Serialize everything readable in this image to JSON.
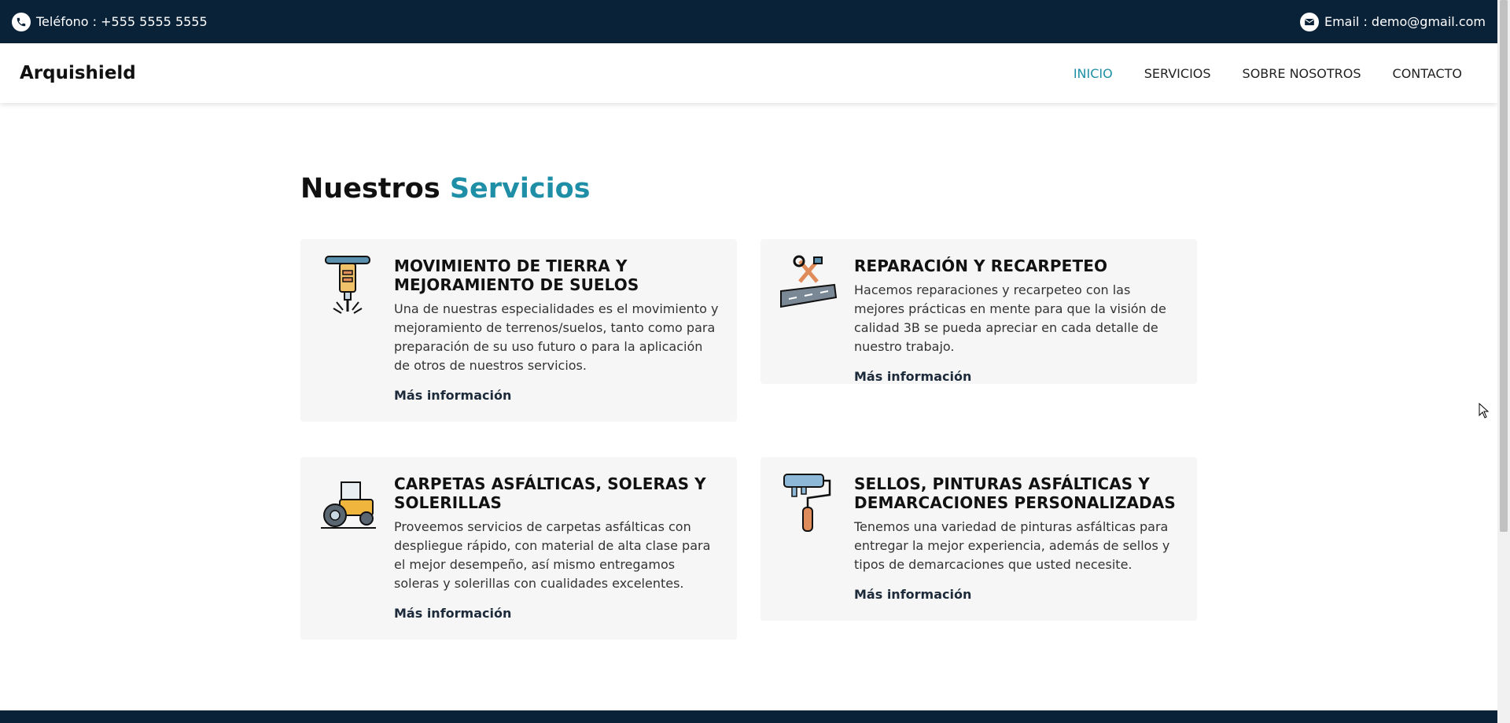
{
  "topbar": {
    "phone_text": "Teléfono : +555 5555 5555",
    "email_text": "Email : demo@gmail.com",
    "phone_icon": "phone-icon",
    "email_icon": "envelope-icon",
    "background": "#0a2238"
  },
  "navbar": {
    "brand": "Arquishield",
    "items": [
      {
        "label": "INICIO",
        "active": true
      },
      {
        "label": "SERVICIOS",
        "active": false
      },
      {
        "label": "SOBRE NOSOTROS",
        "active": false
      },
      {
        "label": "CONTACTO",
        "active": false
      }
    ],
    "accent_color": "#1e8fa6"
  },
  "services": {
    "title_main": "Nuestros",
    "title_accent": "Servicios",
    "cards": [
      {
        "icon": "jackhammer-icon",
        "title": "MOVIMIENTO DE TIERRA Y MEJORAMIENTO DE SUELOS",
        "description": "Una de nuestras especialidades es el movimiento y mejoramiento de terrenos/suelos, tanto como para preparación de su uso futuro o para la aplicación de otros de nuestros servicios.",
        "link": "Más información"
      },
      {
        "icon": "repair-tools-icon",
        "title": "REPARACIÓN Y RECARPETEO",
        "description": "Hacemos reparaciones y recarpeteo con las mejores prácticas en mente para que la visión de calidad 3B se pueda apreciar en cada detalle de nuestro trabajo.",
        "link": "Más información"
      },
      {
        "icon": "road-roller-icon",
        "title": "CARPETAS ASFÁLTICAS, SOLERAS Y SOLERILLAS",
        "description": "Proveemos servicios de carpetas asfálticas con despliegue rápido, con material de alta clase para el mejor desempeño, así mismo entregamos soleras y solerillas con cualidades excelentes.",
        "link": "Más información"
      },
      {
        "icon": "paint-roller-icon",
        "title": "SELLOS, PINTURAS ASFÁLTICAS Y DEMARCACIONES PERSONALIZADAS",
        "description": "Tenemos una variedad de pinturas asfálticas para entregar la mejor experiencia, además de sellos y tipos de demarcaciones que usted necesite.",
        "link": "Más información"
      }
    ]
  }
}
